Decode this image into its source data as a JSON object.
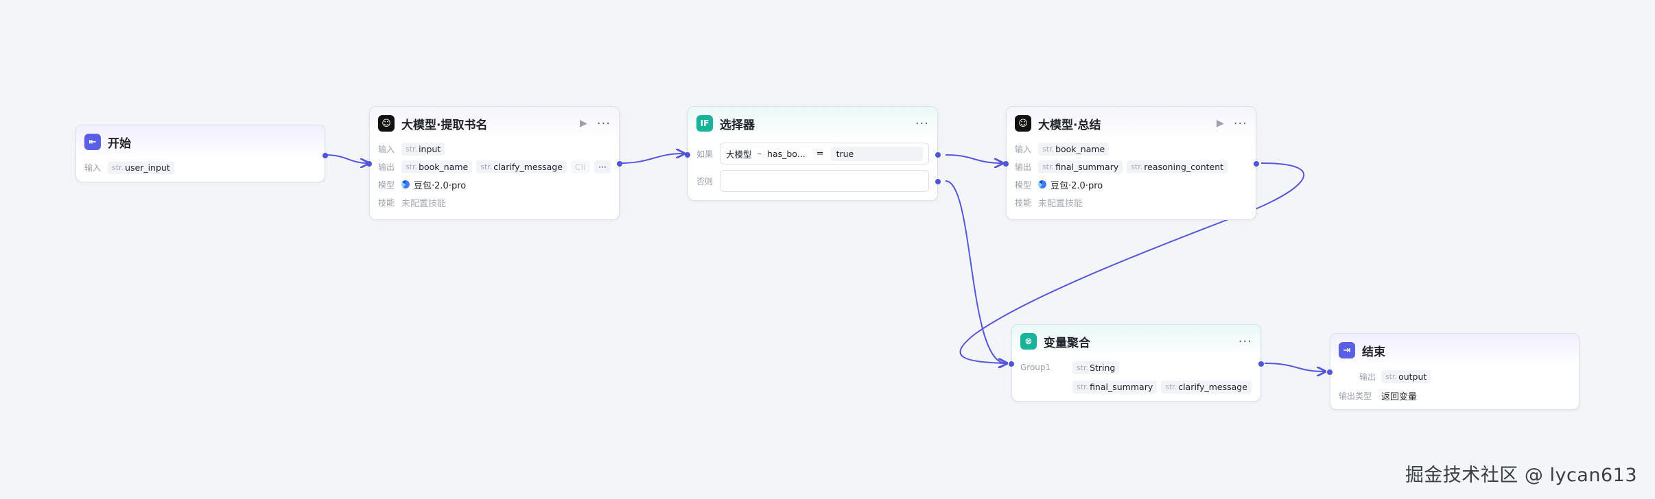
{
  "nodes": {
    "start": {
      "title": "开始",
      "input_label": "输入",
      "input_type": "str.",
      "input_var": "user_input"
    },
    "llm1": {
      "title": "大模型·提取书名",
      "input_label": "输入",
      "input_type": "str.",
      "input_var": "input",
      "output_label": "输出",
      "outputs": [
        {
          "type": "str.",
          "name": "book_name"
        },
        {
          "type": "str.",
          "name": "clarify_message"
        },
        {
          "type": "",
          "name": "Cli"
        }
      ],
      "model_label": "模型",
      "model_name": "豆包·2.0·pro",
      "skill_label": "技能",
      "skill_value": "未配置技能"
    },
    "selector": {
      "title": "选择器",
      "if_label": "如果",
      "else_label": "否则",
      "cond_left": "大模型",
      "cond_sep": "–",
      "cond_var": "has_bo...",
      "cond_op": "=",
      "cond_value": "true"
    },
    "llm2": {
      "title": "大模型·总结",
      "input_label": "输入",
      "input_type": "str.",
      "input_var": "book_name",
      "output_label": "输出",
      "outputs": [
        {
          "type": "str.",
          "name": "final_summary"
        },
        {
          "type": "str.",
          "name": "reasoning_content"
        }
      ],
      "model_label": "模型",
      "model_name": "豆包·2.0·pro",
      "skill_label": "技能",
      "skill_value": "未配置技能"
    },
    "aggregate": {
      "title": "变量聚合",
      "group_label": "Group1",
      "group_type": "str.",
      "group_type_name": "String",
      "vars": [
        {
          "type": "str.",
          "name": "final_summary"
        },
        {
          "type": "str.",
          "name": "clarify_message"
        }
      ]
    },
    "end": {
      "title": "结束",
      "output_label": "输出",
      "output_type": "str.",
      "output_var": "output",
      "output_type_label": "输出类型",
      "output_type_value": "返回变量"
    }
  },
  "icons": {
    "start": "start-icon",
    "llm": "llm-icon",
    "selector": "if-icon",
    "aggregate": "aggregate-icon",
    "end": "end-icon",
    "run": "play-icon",
    "menu": "more-icon"
  },
  "colors": {
    "accent": "#4f55d8",
    "teal": "#18b39a",
    "edge": "#5457d9"
  },
  "watermark": "掘金技术社区 @ lycan613"
}
